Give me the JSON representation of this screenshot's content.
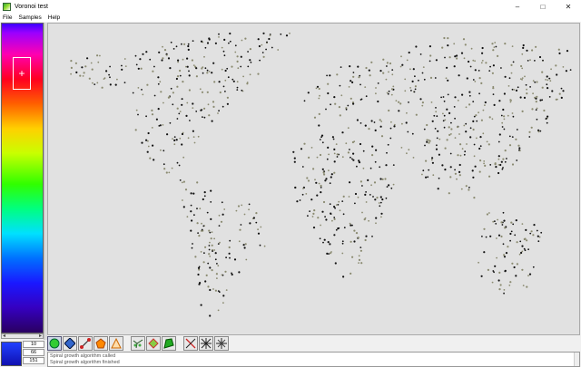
{
  "window": {
    "title": "Voronoi test",
    "minimize": "–",
    "maximize": "□",
    "close": "✕"
  },
  "menu": [
    "File",
    "Samples",
    "Help"
  ],
  "palette": {
    "marker": "+",
    "scroll_left": "◂",
    "scroll_right": "▸"
  },
  "fields": [
    "10",
    "66",
    "151"
  ],
  "toolbar": [
    {
      "name": "circle-tool",
      "icon": "green-circle-icon"
    },
    {
      "name": "diamond-tool",
      "icon": "blue-diamond-icon"
    },
    {
      "name": "line-tool",
      "icon": "segment-icon"
    },
    {
      "name": "polygon-tool",
      "icon": "orange-polygon-icon"
    },
    {
      "name": "triangle-tool",
      "icon": "triangle-icon"
    },
    {
      "name": "voronoi-tool",
      "icon": "voronoi-icon"
    },
    {
      "name": "region-tool",
      "icon": "region-icon"
    },
    {
      "name": "fill-tool",
      "icon": "green-fill-icon"
    },
    {
      "name": "cross-tool",
      "icon": "cross-icon"
    },
    {
      "name": "star-tool",
      "icon": "star-icon"
    },
    {
      "name": "star-alt-tool",
      "icon": "star-alt-icon"
    }
  ],
  "log": [
    "Spiral growth algorithm called",
    "Spiral growth algorithm finished"
  ],
  "colors": {
    "point_dark": "#111111",
    "point_light": "#8a8a70",
    "canvas": "#e1e1e1"
  }
}
